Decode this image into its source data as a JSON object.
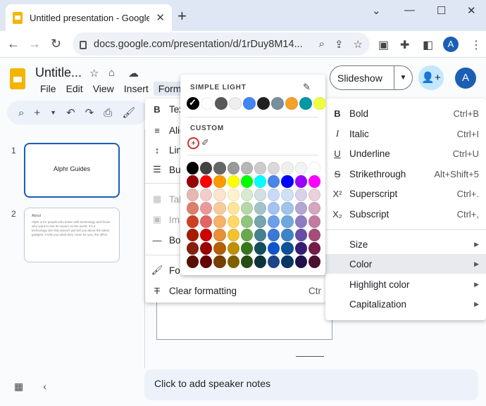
{
  "browser": {
    "tab_title": "Untitled presentation - Google Slides",
    "url": "docs.google.com/presentation/d/1rDuy8M14...",
    "profile_initial": "A"
  },
  "app": {
    "doc_title": "Untitle...",
    "menus": [
      "File",
      "Edit",
      "View",
      "Insert",
      "Format"
    ],
    "slideshow_label": "Slideshow",
    "account_initial": "A"
  },
  "slides": [
    {
      "number": "1",
      "title": "Alphr Guides"
    },
    {
      "number": "2",
      "title": "About",
      "body": "Alphr is for people who tinker with technology and those who want to see its impact on the world. It's a technology site that doesn't just tell you about the latest gadgets; it tells you what they mean for you, the office."
    }
  ],
  "speaker_notes_placeholder": "Click to add speaker notes",
  "format_menu": {
    "items": [
      {
        "icon": "B",
        "label": "Tex",
        "disabled": false
      },
      {
        "icon": "≡",
        "label": "Alig",
        "disabled": false
      },
      {
        "icon": "↕",
        "label": "Lin",
        "disabled": false
      },
      {
        "icon": "☰",
        "label": "Bul",
        "disabled": false
      },
      {
        "icon": "▦",
        "label": "Tab",
        "disabled": true
      },
      {
        "icon": "▣",
        "label": "Ima",
        "disabled": true
      },
      {
        "icon": "—",
        "label": "Bor",
        "disabled": false
      },
      {
        "icon": "🖌",
        "label": "For",
        "disabled": false
      },
      {
        "icon": "T̸",
        "label": "Clear formatting",
        "shortcut": "Ctr",
        "disabled": false
      }
    ]
  },
  "text_menu": {
    "items": [
      {
        "icon": "B",
        "label": "Bold",
        "shortcut": "Ctrl+B"
      },
      {
        "icon": "I",
        "label": "Italic",
        "shortcut": "Ctrl+I"
      },
      {
        "icon": "U",
        "label": "Underline",
        "shortcut": "Ctrl+U"
      },
      {
        "icon": "S",
        "label": "Strikethrough",
        "shortcut": "Alt+Shift+5"
      },
      {
        "icon": "X²",
        "label": "Superscript",
        "shortcut": "Ctrl+."
      },
      {
        "icon": "X₂",
        "label": "Subscript",
        "shortcut": "Ctrl+,"
      }
    ],
    "submenus": [
      {
        "label": "Size",
        "highlighted": false
      },
      {
        "label": "Color",
        "highlighted": true
      },
      {
        "label": "Highlight color",
        "highlighted": false
      },
      {
        "label": "Capitalization",
        "highlighted": false
      }
    ]
  },
  "palette": {
    "theme_title": "SIMPLE LIGHT",
    "custom_title": "CUSTOM",
    "theme_colors": [
      "#000000",
      "#ffffff",
      "#595959",
      "#eeeeee",
      "#4285f4",
      "#212121",
      "#78909c",
      "#f6a12a",
      "#0097a7",
      "#eeff41"
    ],
    "selected_theme_index": 0,
    "grid": [
      [
        "#000000",
        "#434343",
        "#666666",
        "#999999",
        "#b7b7b7",
        "#cccccc",
        "#d9d9d9",
        "#efefef",
        "#f3f3f3",
        "#ffffff"
      ],
      [
        "#980000",
        "#ff0000",
        "#ff9900",
        "#ffff00",
        "#00ff00",
        "#00ffff",
        "#4a86e8",
        "#0000ff",
        "#9900ff",
        "#ff00ff"
      ],
      [
        "#e6b8af",
        "#f4cccc",
        "#fce5cd",
        "#fff2cc",
        "#d9ead3",
        "#d0e0e3",
        "#c9daf8",
        "#cfe2f3",
        "#d9d2e9",
        "#ead1dc"
      ],
      [
        "#dd7e6b",
        "#ea9999",
        "#f9cb9c",
        "#ffe599",
        "#b6d7a8",
        "#a2c4c9",
        "#a4c2f4",
        "#9fc5e8",
        "#b4a7d6",
        "#d5a6bd"
      ],
      [
        "#cc4125",
        "#e06666",
        "#f6b26b",
        "#ffd966",
        "#93c47d",
        "#76a5af",
        "#6d9eeb",
        "#6fa8dc",
        "#8e7cc3",
        "#c27ba0"
      ],
      [
        "#a61c00",
        "#cc0000",
        "#e69138",
        "#f1c232",
        "#6aa84f",
        "#45818e",
        "#3c78d8",
        "#3d85c6",
        "#674ea7",
        "#a64d79"
      ],
      [
        "#85200c",
        "#990000",
        "#b45f06",
        "#bf9000",
        "#38761d",
        "#134f5c",
        "#1155cc",
        "#0b5394",
        "#351c75",
        "#741b47"
      ],
      [
        "#5b0f00",
        "#660000",
        "#783f04",
        "#7f6000",
        "#274e13",
        "#0c343d",
        "#1c4587",
        "#073763",
        "#20124d",
        "#4c1130"
      ]
    ]
  }
}
